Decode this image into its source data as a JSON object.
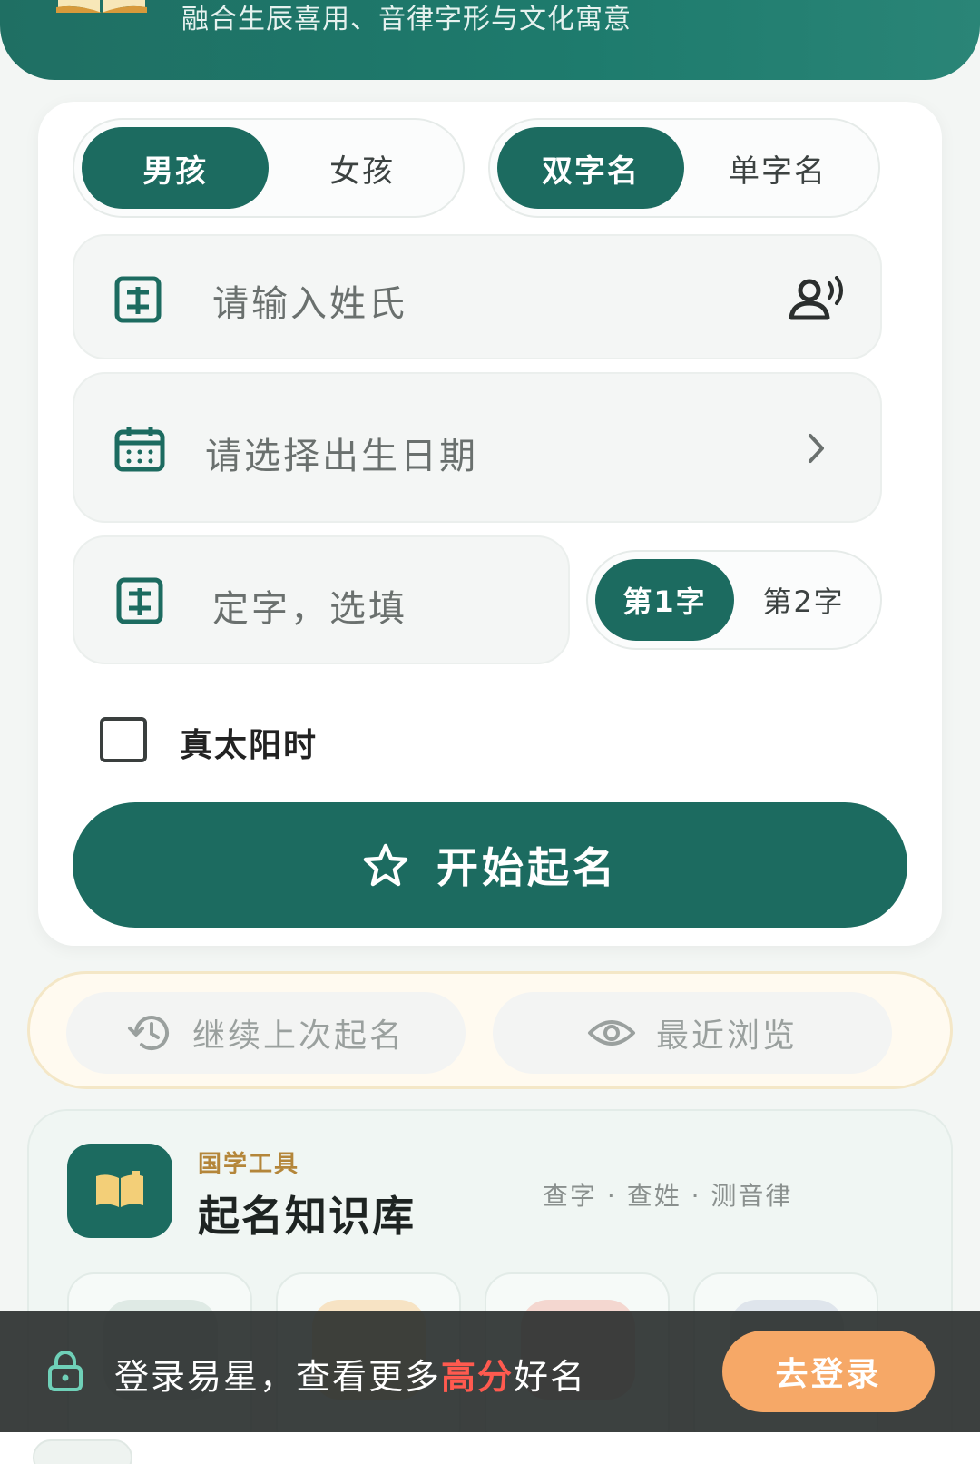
{
  "header": {
    "subtitle": "融合生辰喜用、音律字形与文化寓意"
  },
  "form": {
    "gender": {
      "options": [
        "男孩",
        "女孩"
      ],
      "selected": "男孩"
    },
    "name_length": {
      "options": [
        "双字名",
        "单字名"
      ],
      "selected": "双字名"
    },
    "surname": {
      "placeholder": "请输入姓氏"
    },
    "birth_date": {
      "placeholder": "请选择出生日期"
    },
    "fixed_char": {
      "placeholder": "定字，选填"
    },
    "char_position": {
      "options": [
        "第1字",
        "第2字"
      ],
      "selected": "第1字"
    },
    "true_solar_time": {
      "label": "真太阳时",
      "checked": false
    },
    "start_button": "开始起名"
  },
  "history": {
    "continue_label": "继续上次起名",
    "recent_label": "最近浏览"
  },
  "knowledge": {
    "kicker": "国学工具",
    "title": "起名知识库",
    "links": "查字 · 查姓 · 测音律"
  },
  "login_bar": {
    "message_pre": "登录易星，查看更多",
    "message_highlight": "高分",
    "message_post": "好名",
    "button": "去登录"
  },
  "colors": {
    "primary": "#1c6b60",
    "accent_orange": "#f6a867",
    "highlight_red": "#ff5a4f",
    "kicker_gold": "#b4863a"
  }
}
